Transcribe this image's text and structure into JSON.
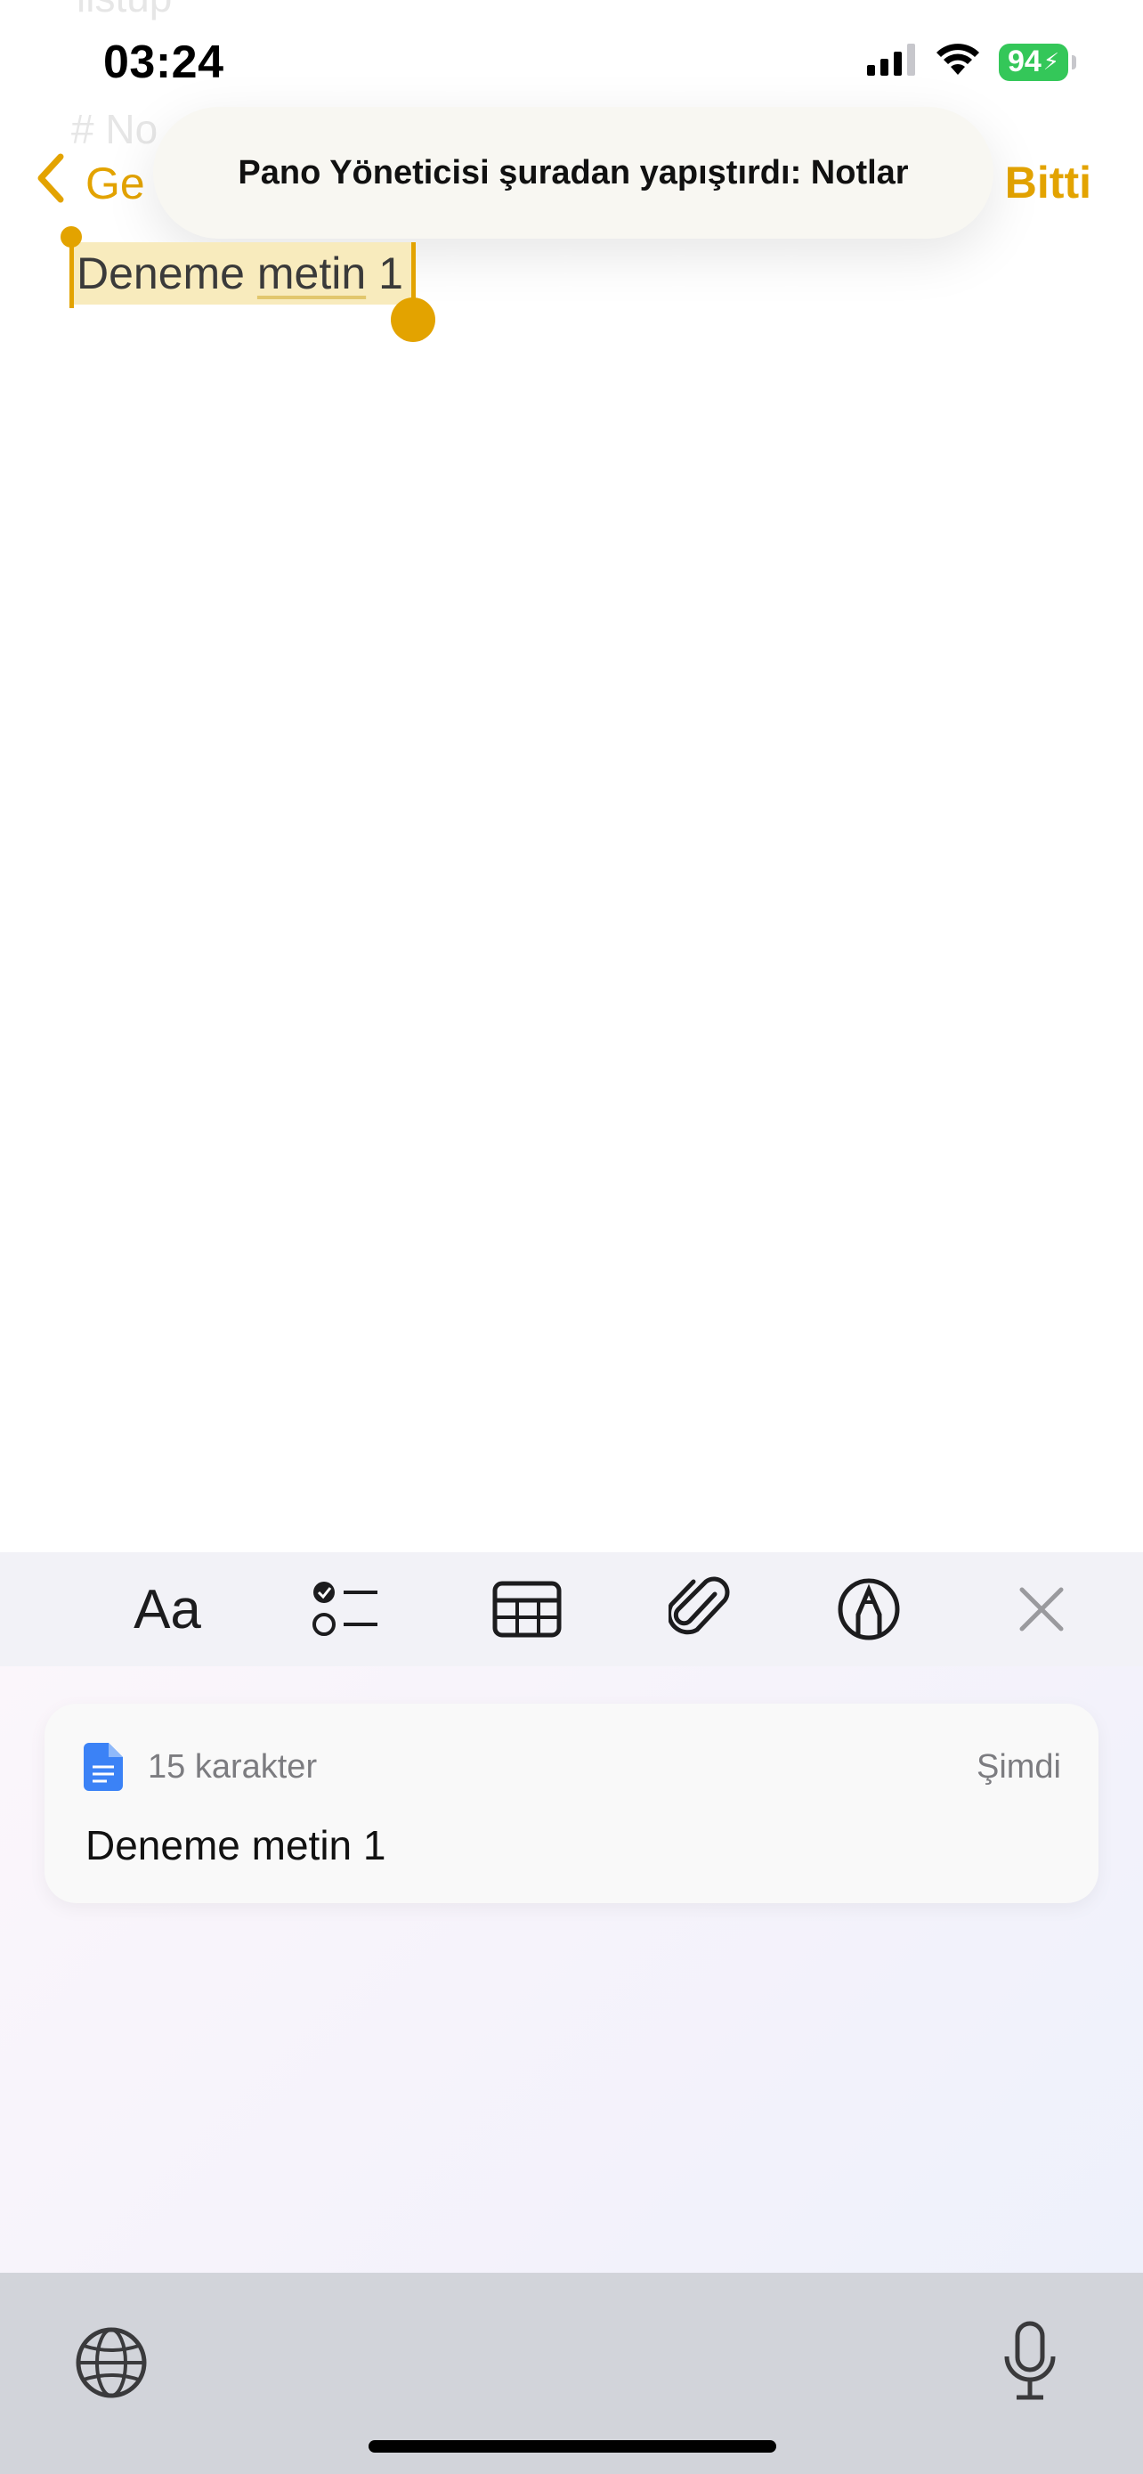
{
  "status_bar": {
    "time": "03:24",
    "battery": "94"
  },
  "background_nav": {
    "faded_title": "listup",
    "faded_heading": "# No",
    "back_label": "Ge",
    "done_label": "Bitti"
  },
  "toast": {
    "message": "Pano Yöneticisi şuradan yapıştırdı: Notlar"
  },
  "note": {
    "word1": "Deneme",
    "word2": "metin",
    "word3": "1"
  },
  "toolbar": {
    "format_label": "Aa",
    "icons": [
      "format-icon",
      "checklist-icon",
      "table-icon",
      "attachment-icon",
      "markup-icon",
      "close-icon"
    ]
  },
  "clipboard": {
    "char_count": "15 karakter",
    "timestamp": "Şimdi",
    "content": "Deneme metin 1"
  },
  "colors": {
    "accent": "#e3a300",
    "battery": "#34c759",
    "doc_icon": "#3b82f6"
  }
}
